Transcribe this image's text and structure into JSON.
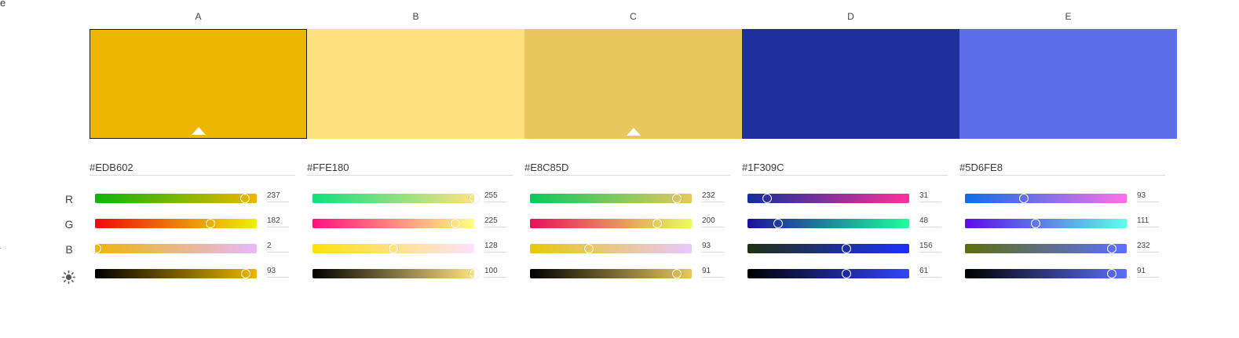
{
  "edge_text": {
    "top_left": "e",
    "mid_left": "-"
  },
  "channels": [
    {
      "key": "R",
      "label": "R",
      "icon": null
    },
    {
      "key": "G",
      "label": "G",
      "icon": null
    },
    {
      "key": "B",
      "label": "B",
      "icon": null
    },
    {
      "key": "L",
      "label": "",
      "icon": "brightness-icon"
    }
  ],
  "swatches": [
    {
      "label": "A",
      "hex": "#EDB602",
      "color": "#EDB602",
      "selected": true,
      "marker": true,
      "values": {
        "R": 237,
        "G": 182,
        "B": 2,
        "L": 93
      },
      "gradients": {
        "R": [
          "#0cb50a",
          "#edb602"
        ],
        "G": [
          "#ed0a0a",
          "#edf00a"
        ],
        "B": [
          "#edb60a",
          "#e8b8fa"
        ],
        "L": [
          "#000000",
          "#edb602"
        ]
      }
    },
    {
      "label": "B",
      "hex": "#FFE180",
      "color": "#FFE180",
      "selected": false,
      "marker": false,
      "values": {
        "R": 255,
        "G": 225,
        "B": 128,
        "L": 100
      },
      "gradients": {
        "R": [
          "#10e080",
          "#ffe180"
        ],
        "G": [
          "#ff1080",
          "#ffff80"
        ],
        "B": [
          "#ffe10a",
          "#ffe1ff"
        ],
        "L": [
          "#000000",
          "#ffe180"
        ]
      }
    },
    {
      "label": "C",
      "hex": "#E8C85D",
      "color": "#E8C85D",
      "selected": false,
      "marker": true,
      "values": {
        "R": 232,
        "G": 200,
        "B": 93,
        "L": 91
      },
      "gradients": {
        "R": [
          "#0ac85d",
          "#e8c85d"
        ],
        "G": [
          "#e8105d",
          "#e8ff5d"
        ],
        "B": [
          "#e8c80a",
          "#e8c8ff"
        ],
        "L": [
          "#000000",
          "#e8c85d"
        ]
      }
    },
    {
      "label": "D",
      "hex": "#1F309C",
      "color": "#1F309C",
      "selected": false,
      "marker": false,
      "values": {
        "R": 31,
        "G": 48,
        "B": 156,
        "L": 61
      },
      "gradients": {
        "R": [
          "#10309c",
          "#ff309c"
        ],
        "G": [
          "#1f109c",
          "#1fff9c"
        ],
        "B": [
          "#1f3010",
          "#1f30ff"
        ],
        "L": [
          "#000000",
          "#3346ff"
        ]
      }
    },
    {
      "label": "E",
      "hex": "#5D6FE8",
      "color": "#5D6FE8",
      "selected": false,
      "marker": false,
      "values": {
        "R": 93,
        "G": 111,
        "B": 232,
        "L": 91
      },
      "gradients": {
        "R": [
          "#0a6fe8",
          "#ff6fe8"
        ],
        "G": [
          "#5d0ae8",
          "#5dffe8"
        ],
        "B": [
          "#5d6f0a",
          "#5d6fff"
        ],
        "L": [
          "#000000",
          "#5d6ff8"
        ]
      }
    }
  ]
}
